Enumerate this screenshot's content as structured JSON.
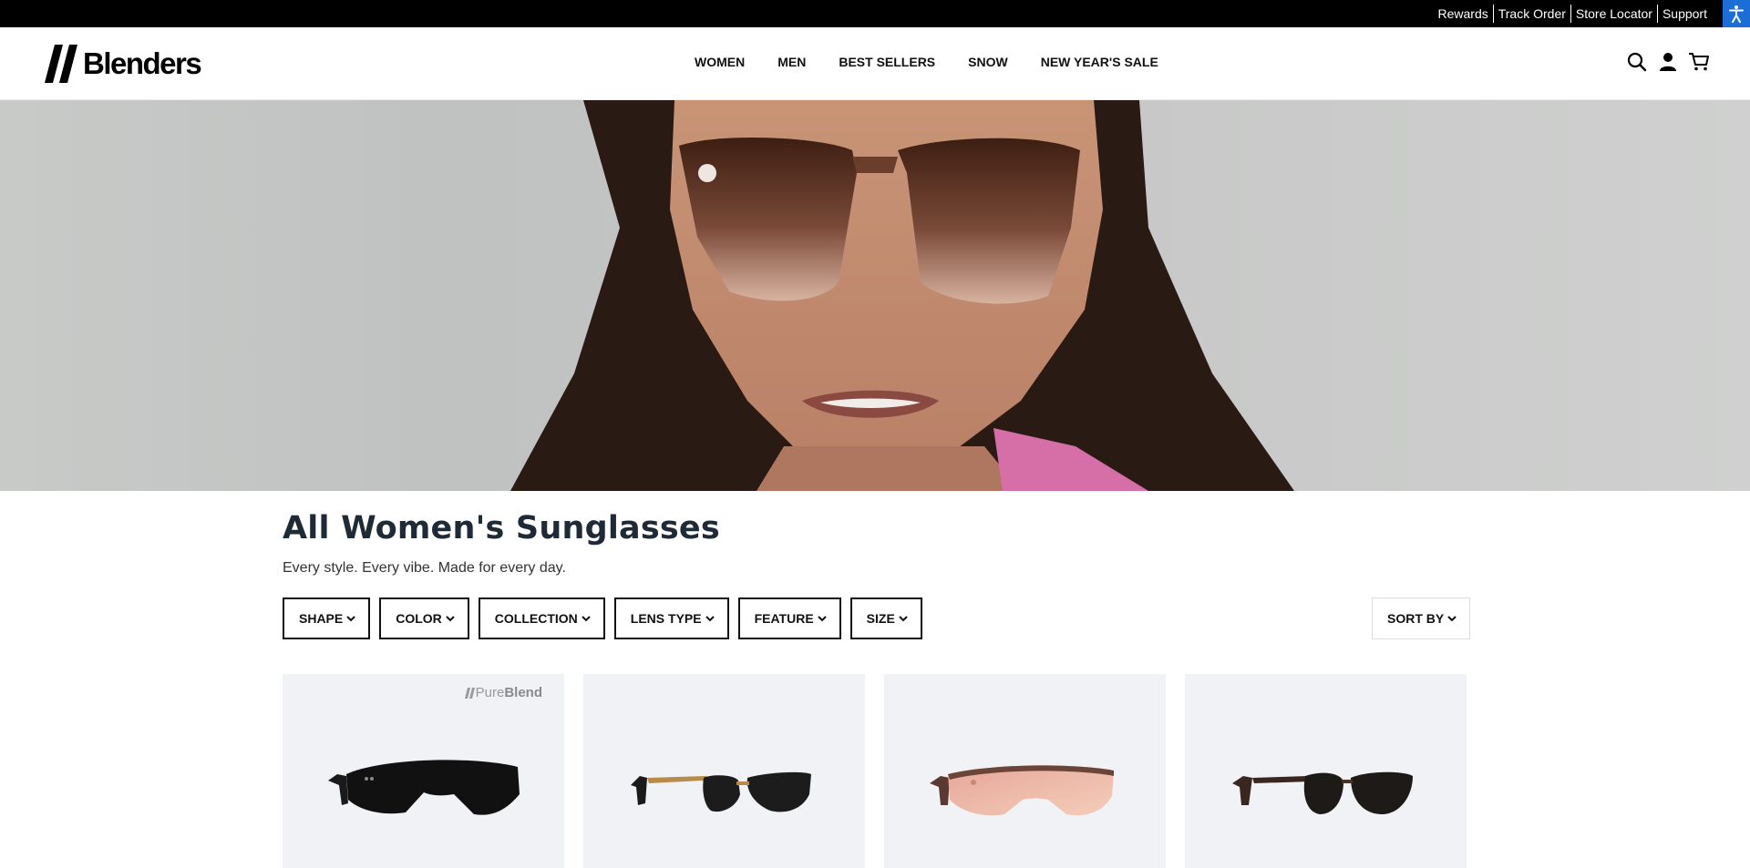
{
  "utility_bar": {
    "links": [
      "Rewards",
      "Track Order",
      "Store Locator",
      "Support"
    ]
  },
  "header": {
    "logo_text": "Blenders",
    "nav": [
      "WOMEN",
      "MEN",
      "BEST SELLERS",
      "SNOW",
      "NEW YEAR'S SALE"
    ],
    "icons": [
      "search-icon",
      "account-icon",
      "cart-icon"
    ]
  },
  "hero": {
    "image": "woman-wearing-brown-gradient-cat-eye-sunglasses"
  },
  "collection": {
    "title": "All Women's Sunglasses",
    "subtitle": "Every style. Every vibe. Made for every day."
  },
  "filters": [
    "SHAPE",
    "COLOR",
    "COLLECTION",
    "LENS TYPE",
    "FEATURE",
    "SIZE"
  ],
  "sort_label": "SORT BY",
  "products": [
    {
      "badge_prefix": "Pure",
      "badge_suffix": "Blend",
      "image": "black-shield-sunglasses"
    },
    {
      "badge_prefix": "",
      "badge_suffix": "",
      "image": "black-gold-half-rim-sunglasses"
    },
    {
      "badge_prefix": "",
      "badge_suffix": "",
      "image": "tortoise-rose-gold-mirror-sunglasses"
    },
    {
      "badge_prefix": "",
      "badge_suffix": "",
      "image": "tortoise-round-smoke-sunglasses"
    }
  ],
  "colors": {
    "utility_bar_bg": "#000000",
    "accessibility_button": "#1b6ed8",
    "title_text": "#1f2a37",
    "card_bg": "#f1f2f5"
  }
}
